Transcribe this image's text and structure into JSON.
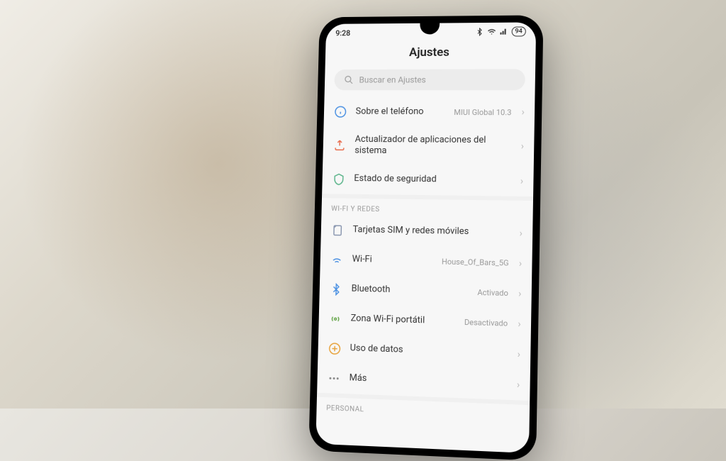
{
  "status": {
    "time": "9:28",
    "battery": "94"
  },
  "header": {
    "title": "Ajustes"
  },
  "search": {
    "placeholder": "Buscar en Ajustes"
  },
  "sections": {
    "main": [
      {
        "label": "Sobre el teléfono",
        "value": "MIUI Global 10.3",
        "icon": "info"
      },
      {
        "label": "Actualizador de aplicaciones del sistema",
        "value": "",
        "icon": "update"
      },
      {
        "label": "Estado de seguridad",
        "value": "",
        "icon": "shield"
      }
    ],
    "networks_header": "WI-FI Y REDES",
    "networks": [
      {
        "label": "Tarjetas SIM y redes móviles",
        "value": "",
        "icon": "sim"
      },
      {
        "label": "Wi-Fi",
        "value": "House_Of_Bars_5G",
        "icon": "wifi"
      },
      {
        "label": "Bluetooth",
        "value": "Activado",
        "icon": "bluetooth"
      },
      {
        "label": "Zona Wi-Fi portátil",
        "value": "Desactivado",
        "icon": "hotspot"
      },
      {
        "label": "Uso de datos",
        "value": "",
        "icon": "data"
      },
      {
        "label": "Más",
        "value": "",
        "icon": "more"
      }
    ],
    "personal_header": "PERSONAL"
  },
  "colors": {
    "info": "#4a90e2",
    "update": "#e86a4a",
    "shield": "#5ab48a",
    "sim": "#8a97b0",
    "wifi": "#4a90e2",
    "bluetooth": "#4a90e2",
    "hotspot": "#6aa84f",
    "data": "#e8a23a",
    "more": "#888"
  }
}
